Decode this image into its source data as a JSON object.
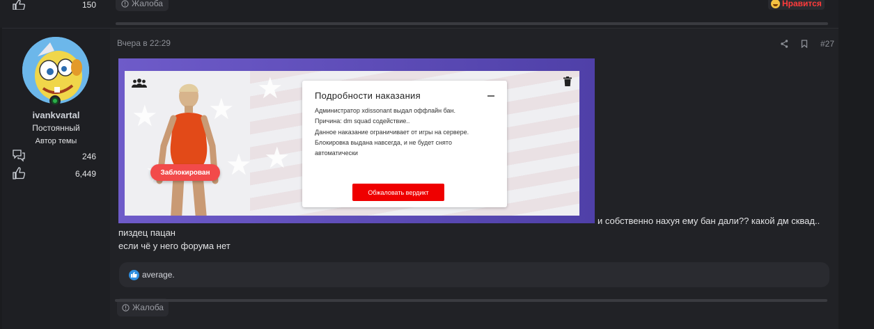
{
  "prev_post": {
    "like_count": "150",
    "report_label": "Жалоба",
    "reaction_label": "Нравится"
  },
  "author": {
    "username": "ivankvartal",
    "title": "Постоянный",
    "badge": "Автор темы",
    "messages": "246",
    "reactions": "6,449"
  },
  "post": {
    "date": "Вчера в 22:29",
    "number": "#27",
    "inline_text": "и собственно нахуя ему бан дали?? какой дм сквад..",
    "lines": [
      "пиздец пацан",
      "если чё у него форума нет"
    ],
    "reaction_user": "average.",
    "report_label": "Жалоба"
  },
  "screenshot": {
    "blocked_label": "Заблокирован",
    "panel_title": "Подробности наказания",
    "panel_lines": [
      "Администратор xdissonant выдал оффлайн бан.",
      "Причина: dm squad содействие..",
      "Данное наказание ограничивает от игры на сервере.",
      "Блокировка выдана навсегда, и не будет снято",
      "автоматически"
    ],
    "appeal_label": "Обжаловать вердикт"
  },
  "colors": {
    "bg": "#1b1c1f",
    "card": "#212226",
    "accent_red": "#ef0000",
    "like_blue": "#2f8fe0",
    "online_green": "#2bb04a"
  },
  "icons": {
    "like": "thumbs-up-icon",
    "messages": "speech-bubbles-icon",
    "share": "share-icon",
    "bookmark": "bookmark-icon",
    "report": "info-circle-icon",
    "group": "users-icon",
    "trash": "trash-icon"
  }
}
